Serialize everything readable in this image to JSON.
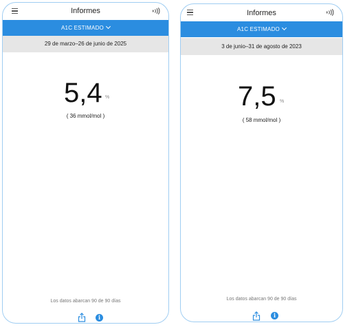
{
  "screens": [
    {
      "title": "Informes",
      "report_type": "A1C ESTIMADO",
      "date_range": "29 de marzo–26 de junio de 2025",
      "a1c_value": "5,4",
      "a1c_unit": "%",
      "mmol": "( 36 mmol/mol )",
      "data_coverage": "Los datos abarcan 90 de 90 días",
      "info_glyph": "i"
    },
    {
      "title": "Informes",
      "report_type": "A1C ESTIMADO",
      "date_range": "3 de junio–31 de agosto de 2023",
      "a1c_value": "7,5",
      "a1c_unit": "%",
      "mmol": "( 58 mmol/mol )",
      "data_coverage": "Los datos abarcan 90 de 90 días",
      "info_glyph": "i"
    }
  ],
  "icons": {
    "menu": "hamburger-menu-icon",
    "nfc": "nfc-scan-icon",
    "dropdown": "chevron-down-icon",
    "share": "share-icon",
    "info": "info-icon"
  },
  "colors": {
    "accent": "#2b8de0",
    "date_bar_bg": "#e6e6e6",
    "phone_border": "#9fcdf2"
  }
}
